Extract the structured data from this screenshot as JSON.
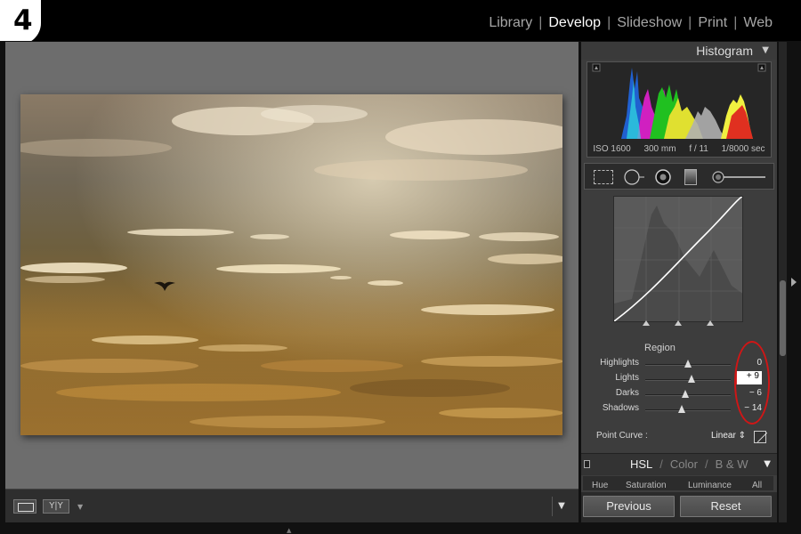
{
  "step_badge": "4",
  "modules": [
    {
      "label": "Library",
      "active": false
    },
    {
      "label": "Develop",
      "active": true
    },
    {
      "label": "Slideshow",
      "active": false
    },
    {
      "label": "Print",
      "active": false
    },
    {
      "label": "Web",
      "active": false
    }
  ],
  "histogram": {
    "title": "Histogram",
    "iso": "ISO 1600",
    "focal_length": "300 mm",
    "aperture": "f / 11",
    "shutter": "1/8000 sec"
  },
  "tools": [
    {
      "name": "crop-overlay-icon"
    },
    {
      "name": "spot-removal-icon"
    },
    {
      "name": "red-eye-icon"
    },
    {
      "name": "graduated-filter-icon"
    },
    {
      "name": "adjustment-brush-icon"
    }
  ],
  "tone_curve": {
    "region_label": "Region",
    "sliders": [
      {
        "label": "Highlights",
        "value": "0",
        "level": 0.5
      },
      {
        "label": "Lights",
        "value": "+ 9",
        "level": 0.54,
        "editing": true
      },
      {
        "label": "Darks",
        "value": "− 6",
        "level": 0.47
      },
      {
        "label": "Shadows",
        "value": "− 14",
        "level": 0.43
      }
    ],
    "point_curve_label": "Point Curve :",
    "point_curve_value": "Linear ⇕"
  },
  "hsl": {
    "tabs": [
      "HSL",
      "Color",
      "B & W"
    ],
    "active_tab": "HSL",
    "subtabs": [
      "Hue",
      "Saturation",
      "Luminance",
      "All"
    ]
  },
  "buttons": {
    "previous": "Previous",
    "reset": "Reset"
  },
  "toolbar": {
    "compare_label": "Y|Y"
  },
  "colors": {
    "annotation_red": "#d01616",
    "panel_bg": "#3d3d3d",
    "center_bg": "#6d6d6d"
  }
}
